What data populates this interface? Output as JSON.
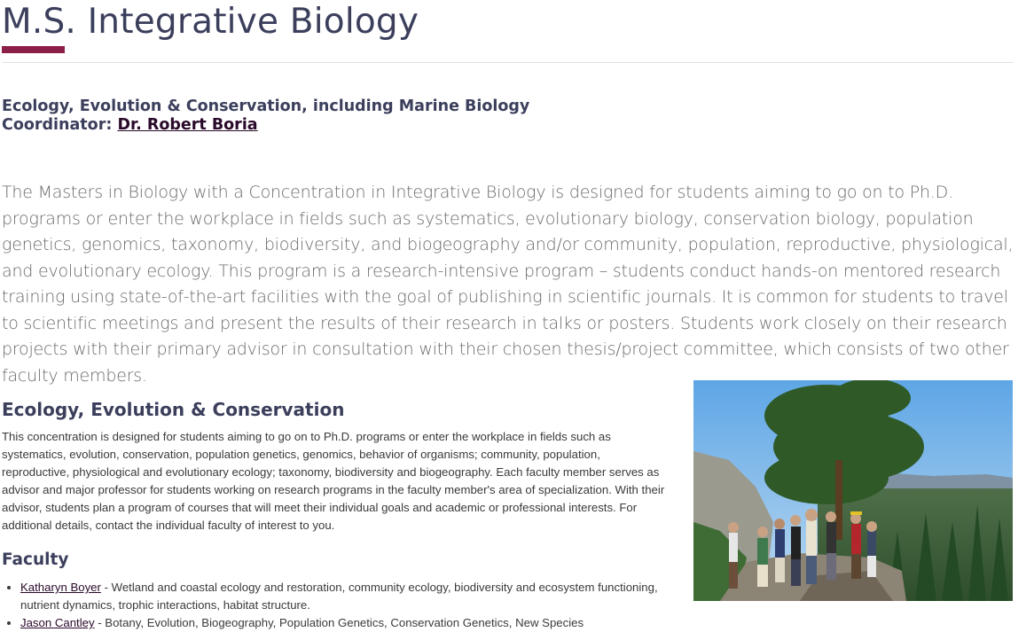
{
  "page": {
    "title": "M.S. Integrative Biology"
  },
  "subheading": {
    "concentration": "Ecology, Evolution & Conservation, including Marine Biology",
    "coordinator_label": "Coordinator:",
    "coordinator_name": "Dr. Robert Boria"
  },
  "intro": {
    "text": "The Masters in Biology with a Concentration in Integrative Biology is designed for students aiming to go on to Ph.D. programs or enter the workplace in fields such as systematics, evolutionary biology, conservation biology, population genetics, genomics, taxonomy, biodiversity, and biogeography and/or community, population, reproductive, physiological, and evolutionary ecology. This program is a research-intensive program – students conduct hands-on mentored research training using state-of-the-art facilities with the goal of publishing in scientific journals. It is common for students to travel to scientific meetings and present the results of their research in talks or posters. Students work closely on their research projects with their primary advisor in consultation with their chosen thesis/project committee, which consists of two other faculty members."
  },
  "section": {
    "heading": "Ecology, Evolution & Conservation",
    "body": "This concentration is designed for students aiming to go on to Ph.D. programs or enter the workplace in fields such as systematics, evolution, conservation, population genetics, genomics, behavior of organisms; community, population, reproductive, physiological and evolutionary ecology; taxonomy, biodiversity and biogeography. Each faculty member serves as advisor and major professor for students working on research programs in the faculty member's area of specialization. With their advisor, students plan a program of courses that will meet their individual goals and academic or professional interests. For additional details, contact the individual faculty of interest to you."
  },
  "faculty": {
    "heading": "Faculty",
    "members": [
      {
        "name": "Katharyn Boyer",
        "description": " - Wetland and coastal ecology and restoration, community ecology, biodiversity and ecosystem functioning, nutrient dynamics, trophic interactions, habitat structure."
      },
      {
        "name": "Jason Cantley",
        "description": " - Botany, Evolution, Biogeography, Population Genetics, Conservation Genetics, New Species"
      }
    ]
  },
  "photo": {
    "alt": "Students on a field trip standing on a rocky outcrop beside a pine tree overlooking a forested valley"
  },
  "colors": {
    "title": "#3b3f5c",
    "accent": "#8b1f48",
    "link": "#2a0a2a",
    "intro_text": "#6a6a6a"
  }
}
